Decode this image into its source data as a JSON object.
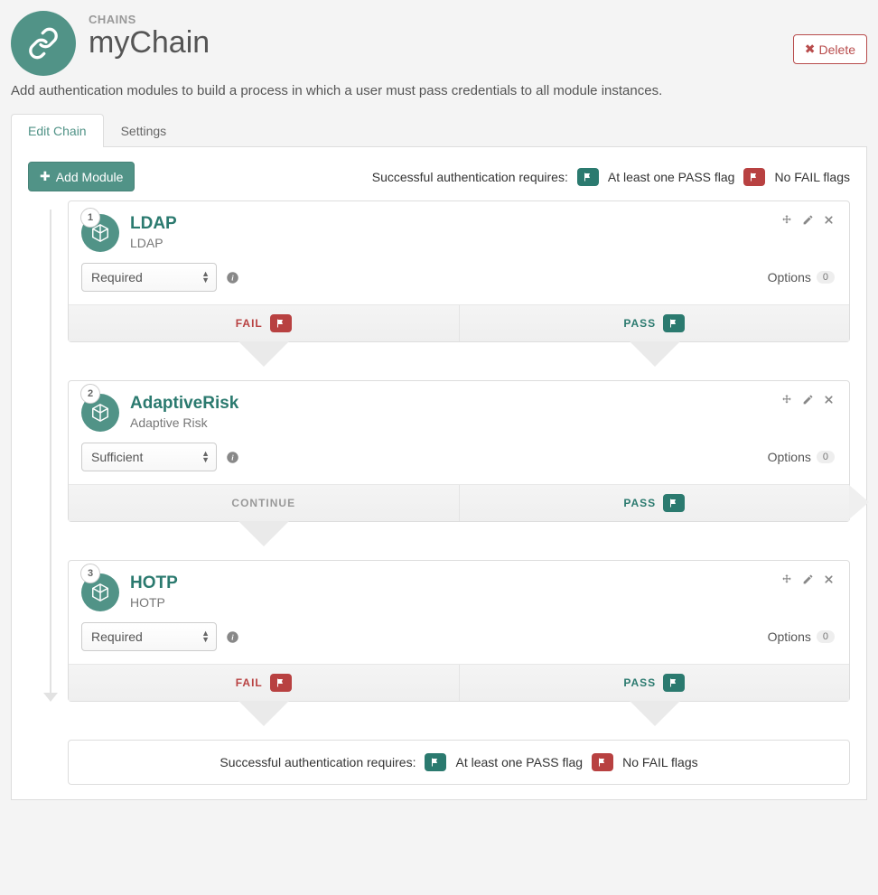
{
  "breadcrumb": "CHAINS",
  "title": "myChain",
  "delete_label": "Delete",
  "description": "Add authentication modules to build a process in which a user must pass credentials to all module instances.",
  "tabs": [
    {
      "label": "Edit Chain",
      "active": true
    },
    {
      "label": "Settings",
      "active": false
    }
  ],
  "add_module_label": "Add Module",
  "requires_text": "Successful authentication requires:",
  "pass_flag_text": "At least one PASS flag",
  "fail_flag_text": "No FAIL flags",
  "options_label": "Options",
  "outcome": {
    "fail": "FAIL",
    "pass": "PASS",
    "continue": "CONTINUE"
  },
  "colors": {
    "teal": "#519387",
    "red": "#b84141"
  },
  "modules": [
    {
      "num": "1",
      "title": "LDAP",
      "subtitle": "LDAP",
      "criteria": "Required",
      "options_count": "0",
      "left": "fail",
      "right": "pass"
    },
    {
      "num": "2",
      "title": "AdaptiveRisk",
      "subtitle": "Adaptive Risk",
      "criteria": "Sufficient",
      "options_count": "0",
      "left": "continue",
      "right": "pass_exit"
    },
    {
      "num": "3",
      "title": "HOTP",
      "subtitle": "HOTP",
      "criteria": "Required",
      "options_count": "0",
      "left": "fail",
      "right": "pass"
    }
  ]
}
